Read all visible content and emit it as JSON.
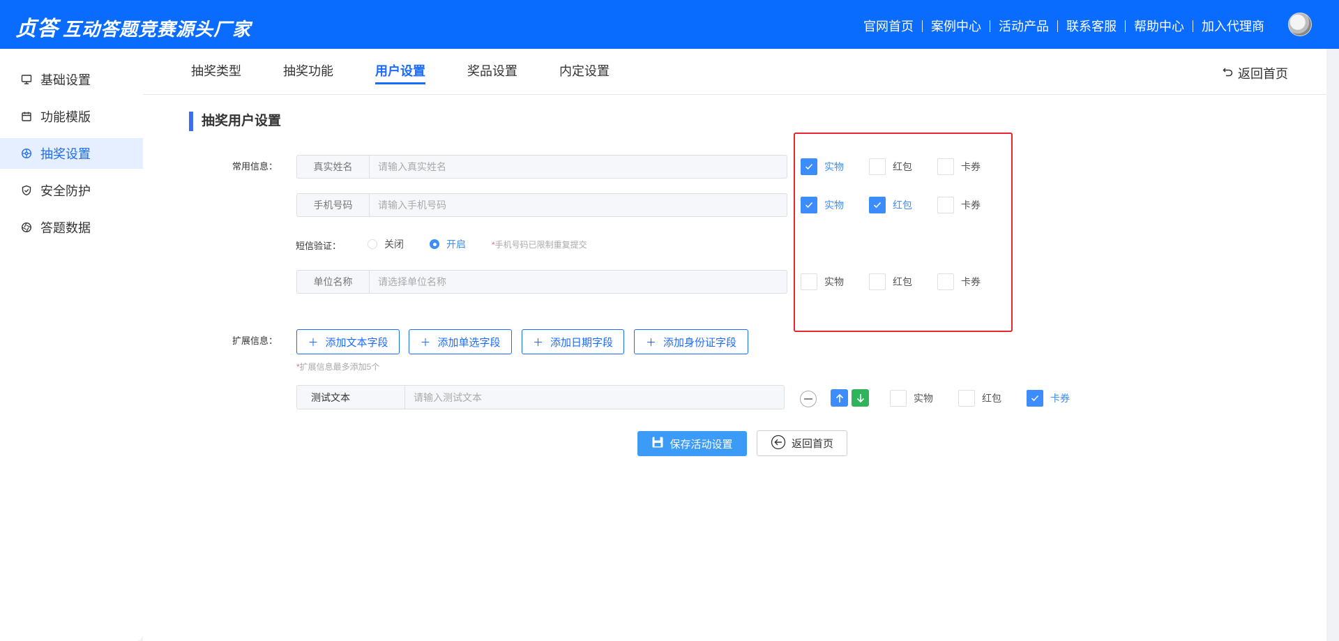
{
  "header": {
    "logo": "贞答",
    "slogan": "互动答题竞赛源头厂家",
    "nav": [
      "官网首页",
      "案例中心",
      "活动产品",
      "联系客服",
      "帮助中心",
      "加入代理商"
    ]
  },
  "sidebar": {
    "items": [
      {
        "label": "基础设置",
        "icon": "monitor-icon"
      },
      {
        "label": "功能模版",
        "icon": "calendar-icon"
      },
      {
        "label": "抽奖设置",
        "icon": "prize-wheel-icon",
        "active": true
      },
      {
        "label": "安全防护",
        "icon": "shield-icon"
      },
      {
        "label": "答题数据",
        "icon": "aperture-icon"
      }
    ]
  },
  "tabs": {
    "items": [
      "抽奖类型",
      "抽奖功能",
      "用户设置",
      "奖品设置",
      "内定设置"
    ],
    "active": "用户设置",
    "back_home": "返回首页"
  },
  "section_title": "抽奖用户设置",
  "common": {
    "label": "常用信息：",
    "fields": [
      {
        "prefix": "真实姓名",
        "placeholder": "请输入真实姓名",
        "value": ""
      },
      {
        "prefix": "手机号码",
        "placeholder": "请输入手机号码",
        "value": ""
      },
      {
        "prefix": "单位名称",
        "placeholder": "请选择单位名称",
        "value": ""
      }
    ],
    "sms": {
      "label": "短信验证：",
      "off": "关闭",
      "on": "开启",
      "selected": "开启",
      "hint_star": "*",
      "hint": "手机号码已限制重复提交"
    }
  },
  "prize_options": [
    "实物",
    "红包",
    "卡券"
  ],
  "prize_checks": [
    [
      true,
      false,
      false
    ],
    [
      true,
      true,
      false
    ],
    [
      false,
      false,
      false
    ]
  ],
  "extended": {
    "label": "扩展信息：",
    "buttons": [
      "添加文本字段",
      "添加单选字段",
      "添加日期字段",
      "添加身份证字段"
    ],
    "hint_star": "*",
    "hint": "扩展信息最多添加5个",
    "field": {
      "prefix": "测试文本",
      "placeholder": "请输入测试文本",
      "value": ""
    },
    "field_checks": [
      false,
      false,
      true
    ]
  },
  "footer": {
    "save": "保存活动设置",
    "back": "返回首页"
  },
  "colors": {
    "header_bg": "#0a6cff",
    "accent": "#1c6bff",
    "checkbox_checked": "#3c8dfb",
    "arrow_up": "#3c8dfb",
    "arrow_down": "#2fb45a",
    "highlight_box": "#e5262c"
  }
}
